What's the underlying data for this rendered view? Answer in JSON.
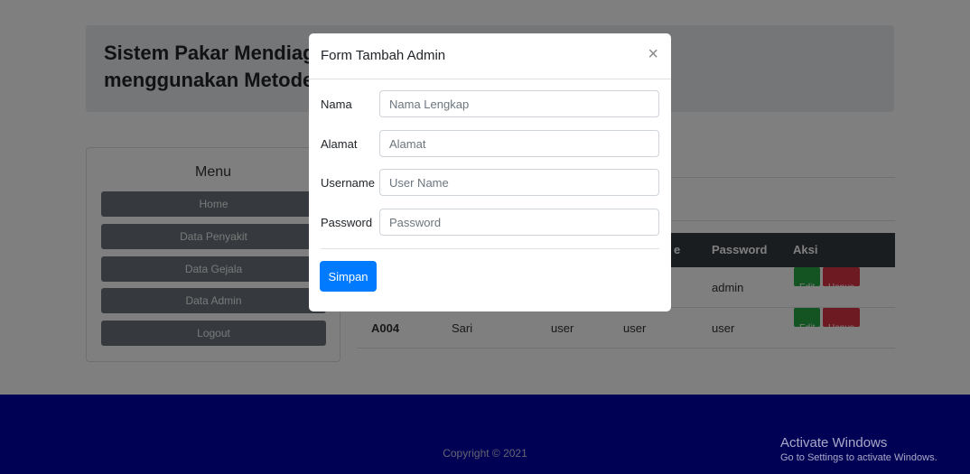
{
  "header": {
    "title": "Sistem Pakar Mendiagnosa Penyakit Lupus Eritematosus menggunakan Metode"
  },
  "sidebar": {
    "title": "Menu",
    "items": [
      {
        "label": "Home"
      },
      {
        "label": "Data Penyakit"
      },
      {
        "label": "Data Gejala"
      },
      {
        "label": "Data Admin"
      },
      {
        "label": "Logout"
      }
    ]
  },
  "table": {
    "columns": [
      "",
      "",
      "",
      "e",
      "Password",
      "Aksi"
    ],
    "rows": [
      {
        "id": "",
        "name": "",
        "alamat": "",
        "username": "",
        "password": "admin"
      },
      {
        "id": "A004",
        "name": "Sari",
        "alamat": "user",
        "username": "user",
        "password": "user"
      }
    ],
    "edit_label": "Edit",
    "delete_label": "Hapus"
  },
  "modal": {
    "title": "Form Tambah Admin",
    "close_glyph": "×",
    "fields": [
      {
        "label": "Nama",
        "placeholder": "Nama Lengkap",
        "value": ""
      },
      {
        "label": "Alamat",
        "placeholder": "Alamat",
        "value": ""
      },
      {
        "label": "Username",
        "placeholder": "User Name",
        "value": ""
      },
      {
        "label": "Password",
        "placeholder": "Password",
        "value": ""
      }
    ],
    "submit_label": "Simpan"
  },
  "footer": {
    "copyright": "Copyright © 2021"
  },
  "watermark": {
    "line1": "Activate Windows",
    "line2": "Go to Settings to activate Windows."
  },
  "colors": {
    "primary": "#007bff",
    "footer": "#0000a8",
    "edit": "#28a745",
    "delete": "#dc3545",
    "menu": "#6c757d"
  }
}
